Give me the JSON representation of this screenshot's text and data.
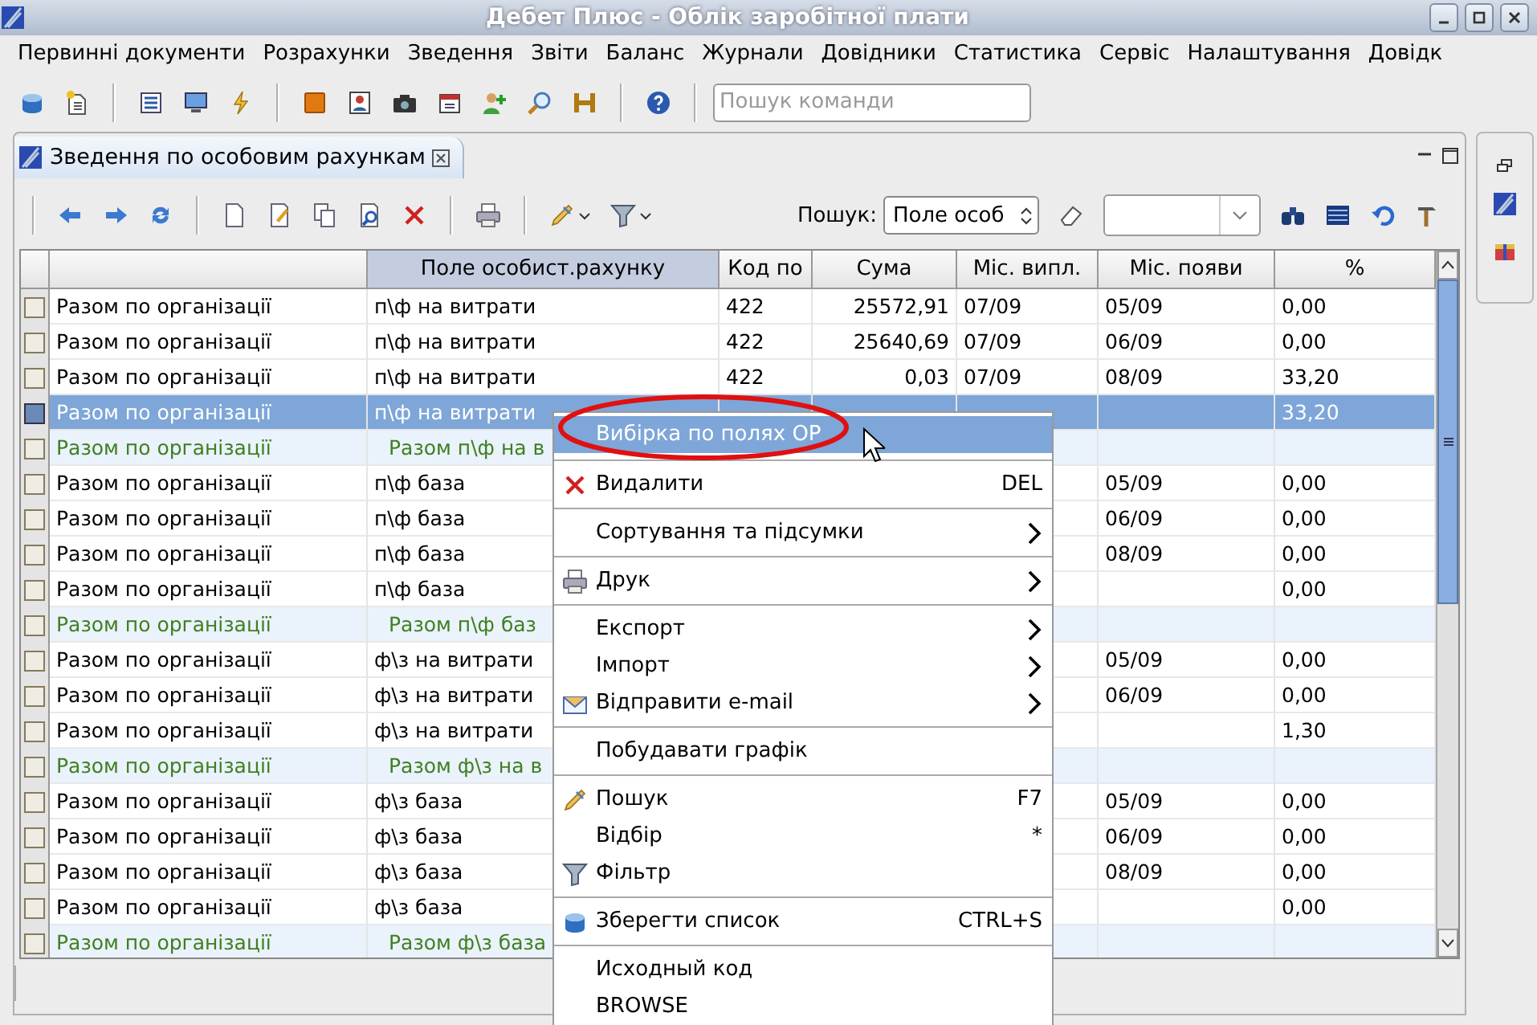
{
  "window": {
    "title": "Дебет Плюс - Облік заробітної плати"
  },
  "menu_bar": [
    "Первинні документи",
    "Розрахунки",
    "Зведення",
    "Звіти",
    "Баланс",
    "Журнали",
    "Довідники",
    "Статистика",
    "Сервіс",
    "Налаштування",
    "Довідк"
  ],
  "command_search": {
    "placeholder": "Пошук команди"
  },
  "tab": {
    "label": "Зведення по особовим рахункам"
  },
  "toolbar": {
    "search_label": "Пошук:",
    "search_field": {
      "value": "Поле особ"
    }
  },
  "table": {
    "columns": [
      {
        "label": "Поле особист.рахунку",
        "selected": true
      },
      {
        "label": "Код по",
        "selected": false
      },
      {
        "label": "Сума",
        "selected": false
      },
      {
        "label": "Міс. випл.",
        "selected": false
      },
      {
        "label": "Міс. появи",
        "selected": false
      },
      {
        "label": "%",
        "selected": false
      }
    ],
    "rows": [
      {
        "kind": "detail",
        "selected": false,
        "organization": "Разом по організації",
        "account": "п\\ф на витрати",
        "code": "422",
        "sum": "25572,91",
        "pay_month": "07/09",
        "appear_month": "05/09",
        "percent": "0,00"
      },
      {
        "kind": "detail",
        "selected": false,
        "organization": "Разом по організації",
        "account": "п\\ф на витрати",
        "code": "422",
        "sum": "25640,69",
        "pay_month": "07/09",
        "appear_month": "06/09",
        "percent": "0,00"
      },
      {
        "kind": "detail",
        "selected": false,
        "organization": "Разом по організації",
        "account": "п\\ф на витрати",
        "code": "422",
        "sum": "0,03",
        "pay_month": "07/09",
        "appear_month": "08/09",
        "percent": "33,20"
      },
      {
        "kind": "detail",
        "selected": true,
        "organization": "Разом по організації",
        "account": "п\\ф на витрати",
        "percent": "33,20"
      },
      {
        "kind": "total",
        "selected": false,
        "organization": "Разом по організації",
        "account": "Разом п\\ф на в"
      },
      {
        "kind": "detail",
        "selected": false,
        "organization": "Разом по організації",
        "account": "п\\ф база",
        "appear_month": "05/09",
        "percent": "0,00"
      },
      {
        "kind": "detail",
        "selected": false,
        "organization": "Разом по організації",
        "account": "п\\ф база",
        "appear_month": "06/09",
        "percent": "0,00"
      },
      {
        "kind": "detail",
        "selected": false,
        "organization": "Разом по організації",
        "account": "п\\ф база",
        "appear_month": "08/09",
        "percent": "0,00"
      },
      {
        "kind": "detail",
        "selected": false,
        "organization": "Разом по організації",
        "account": "п\\ф база",
        "percent": "0,00"
      },
      {
        "kind": "total",
        "selected": false,
        "organization": "Разом по організації",
        "account": "Разом п\\ф баз"
      },
      {
        "kind": "detail",
        "selected": false,
        "organization": "Разом по організації",
        "account": "ф\\з на витрати",
        "appear_month": "05/09",
        "percent": "0,00"
      },
      {
        "kind": "detail",
        "selected": false,
        "organization": "Разом по організації",
        "account": "ф\\з на витрати",
        "appear_month": "06/09",
        "percent": "0,00"
      },
      {
        "kind": "detail",
        "selected": false,
        "organization": "Разом по організації",
        "account": "ф\\з на витрати",
        "percent": "1,30"
      },
      {
        "kind": "total",
        "selected": false,
        "organization": "Разом по організації",
        "account": "Разом ф\\з на в"
      },
      {
        "kind": "detail",
        "selected": false,
        "organization": "Разом по організації",
        "account": "ф\\з база",
        "appear_month": "05/09",
        "percent": "0,00"
      },
      {
        "kind": "detail",
        "selected": false,
        "organization": "Разом по організації",
        "account": "ф\\з база",
        "appear_month": "06/09",
        "percent": "0,00"
      },
      {
        "kind": "detail",
        "selected": false,
        "organization": "Разом по організації",
        "account": "ф\\з база",
        "appear_month": "08/09",
        "percent": "0,00"
      },
      {
        "kind": "detail",
        "selected": false,
        "organization": "Разом по організації",
        "account": "ф\\з база",
        "percent": "0,00"
      },
      {
        "kind": "total",
        "selected": false,
        "organization": "Разом по організації",
        "account": "Разом ф\\з база"
      }
    ]
  },
  "context_menu": {
    "items": [
      {
        "kind": "item",
        "label": "Вибірка по полях ОР",
        "selected": true,
        "submenu": false
      },
      {
        "kind": "separator"
      },
      {
        "kind": "item",
        "label": "Видалити",
        "shortcut": "DEL",
        "selected": false,
        "submenu": false
      },
      {
        "kind": "separator"
      },
      {
        "kind": "item",
        "label": "Сортування та підсумки",
        "selected": false,
        "submenu": true
      },
      {
        "kind": "separator"
      },
      {
        "kind": "item",
        "label": "Друк",
        "selected": false,
        "submenu": true
      },
      {
        "kind": "separator"
      },
      {
        "kind": "item",
        "label": "Експорт",
        "selected": false,
        "submenu": true
      },
      {
        "kind": "item",
        "label": "Імпорт",
        "selected": false,
        "submenu": true
      },
      {
        "kind": "item",
        "label": "Відправити e-mail",
        "selected": false,
        "submenu": true
      },
      {
        "kind": "separator"
      },
      {
        "kind": "item",
        "label": "Побудавати графік",
        "selected": false,
        "submenu": false
      },
      {
        "kind": "separator"
      },
      {
        "kind": "item",
        "label": "Пошук",
        "shortcut": "F7",
        "selected": false,
        "submenu": false
      },
      {
        "kind": "item",
        "label": "Відбір",
        "shortcut": "*",
        "selected": false,
        "submenu": false
      },
      {
        "kind": "item",
        "label": "Фільтр",
        "selected": false,
        "submenu": false
      },
      {
        "kind": "separator"
      },
      {
        "kind": "item",
        "label": "Зберегти список",
        "shortcut": "CTRL+S",
        "selected": false,
        "submenu": false
      },
      {
        "kind": "separator"
      },
      {
        "kind": "item",
        "label": "Исходный код",
        "selected": false,
        "submenu": false
      },
      {
        "kind": "item",
        "label": "BROWSE",
        "selected": false,
        "submenu": false
      }
    ]
  }
}
